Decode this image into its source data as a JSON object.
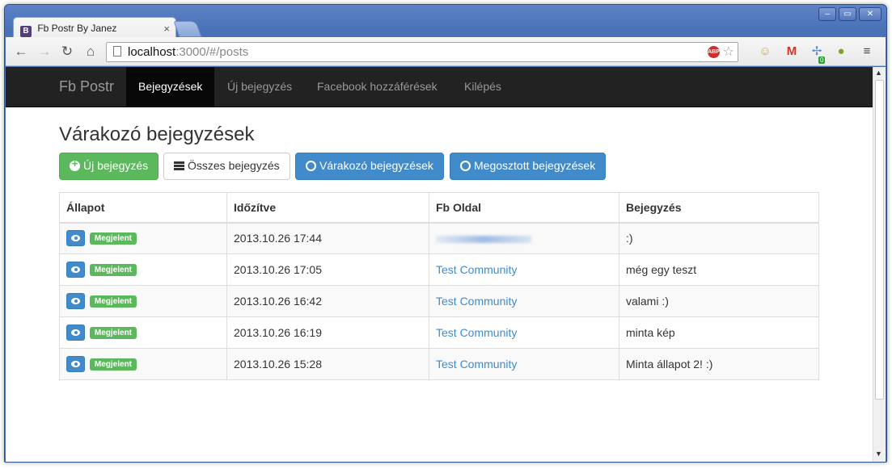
{
  "browser": {
    "tab_title": "Fb Postr By Janez",
    "favicon_letter": "B",
    "url_host": "localhost",
    "url_rest": ":3000/#/posts",
    "abp_label": "ABP",
    "extension_badge": "0"
  },
  "navbar": {
    "brand": "Fb Postr",
    "items": [
      {
        "label": "Bejegyzések",
        "active": true
      },
      {
        "label": "Új bejegyzés",
        "active": false
      },
      {
        "label": "Facebook hozzáférések",
        "active": false
      },
      {
        "label": "Kilépés",
        "active": false
      }
    ]
  },
  "page": {
    "title": "Várakozó bejegyzések",
    "buttons": {
      "new_post": "Új bejegyzés",
      "all_posts": "Összes bejegyzés",
      "pending_posts": "Várakozó bejegyzések",
      "shared_posts": "Megosztott bejegyzések"
    }
  },
  "table": {
    "headers": [
      "Állapot",
      "Időzítve",
      "Fb Oldal",
      "Bejegyzés"
    ],
    "rows": [
      {
        "status": "Megjelent",
        "time": "2013.10.26 17:44",
        "page": "",
        "post": ":)"
      },
      {
        "status": "Megjelent",
        "time": "2013.10.26 17:05",
        "page": "Test Community",
        "post": "még egy teszt"
      },
      {
        "status": "Megjelent",
        "time": "2013.10.26 16:42",
        "page": "Test Community",
        "post": "valami :)"
      },
      {
        "status": "Megjelent",
        "time": "2013.10.26 16:19",
        "page": "Test Community",
        "post": "minta kép"
      },
      {
        "status": "Megjelent",
        "time": "2013.10.26 15:28",
        "page": "Test Community",
        "post": "Minta állapot 2! :)"
      }
    ]
  },
  "colors": {
    "primary": "#428bca",
    "success": "#5cb85c",
    "navbar": "#222222"
  }
}
